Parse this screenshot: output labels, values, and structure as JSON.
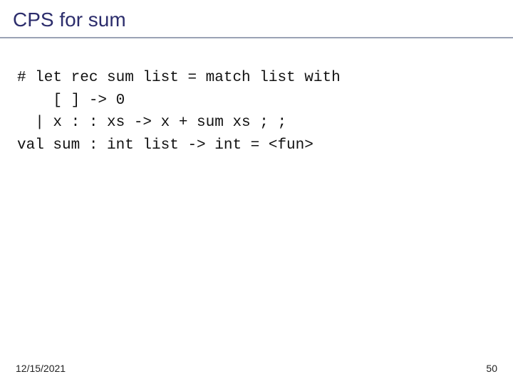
{
  "title": "CPS for sum",
  "code_lines": [
    "# let rec sum list = match list with",
    "    [ ] -> 0",
    "  | x : : xs -> x + sum xs ; ;",
    "val sum : int list -> int = <fun>"
  ],
  "footer": {
    "date": "12/15/2021",
    "page": "50"
  }
}
